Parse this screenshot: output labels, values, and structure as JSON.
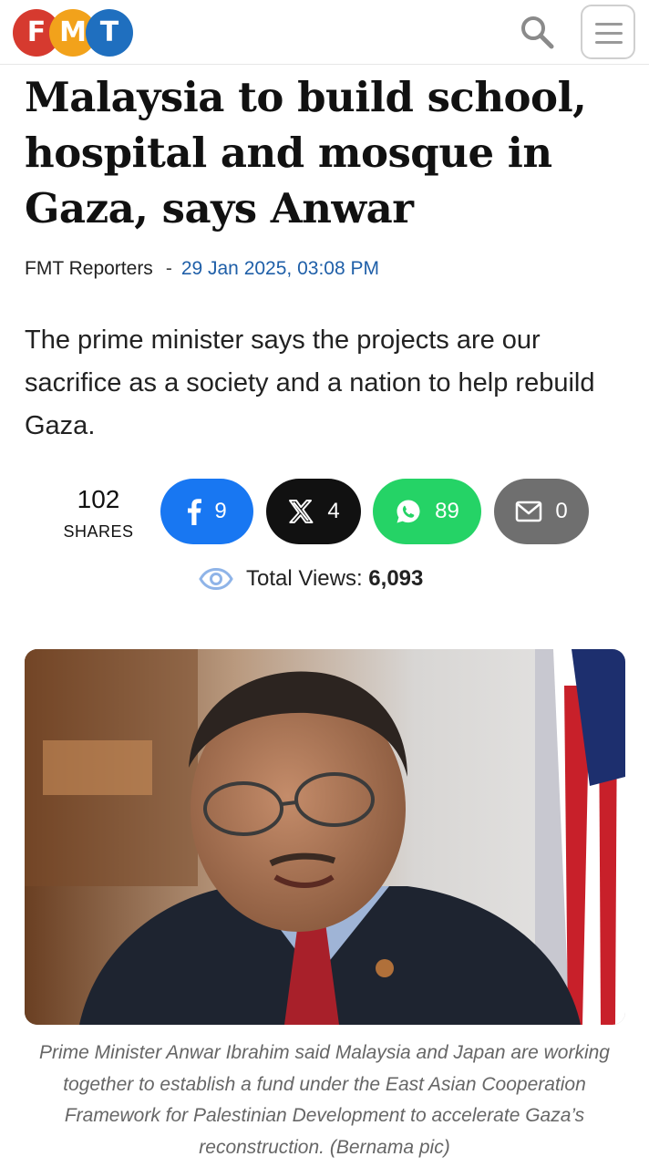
{
  "header": {
    "logo_letters": [
      "F",
      "M",
      "T"
    ],
    "brand_colors": {
      "f": "#d63a2f",
      "m": "#f2a21b",
      "t": "#1f6fbf"
    },
    "search_icon": "search-icon",
    "menu_icon": "hamburger-menu-icon"
  },
  "article": {
    "title": "Malaysia to build school, hospital and mosque in Gaza, says Anwar",
    "author": "FMT Reporters",
    "separator": "-",
    "date": "29 Jan 2025, 03:08 PM",
    "summary": "The prime minister says the projects are our sacrifice as a society and a nation to help rebuild Gaza."
  },
  "shares": {
    "total": "102",
    "label": "SHARES",
    "facebook": "9",
    "x": "4",
    "whatsapp": "89",
    "email": "0"
  },
  "views": {
    "label": "Total Views:",
    "count": "6,093"
  },
  "photo": {
    "caption": "Prime Minister Anwar Ibrahim said Malaysia and Japan are working together to establish a fund under the East Asian Cooperation Framework for Palestinian Development to accelerate Gaza’s reconstruction. (Bernama pic)"
  }
}
